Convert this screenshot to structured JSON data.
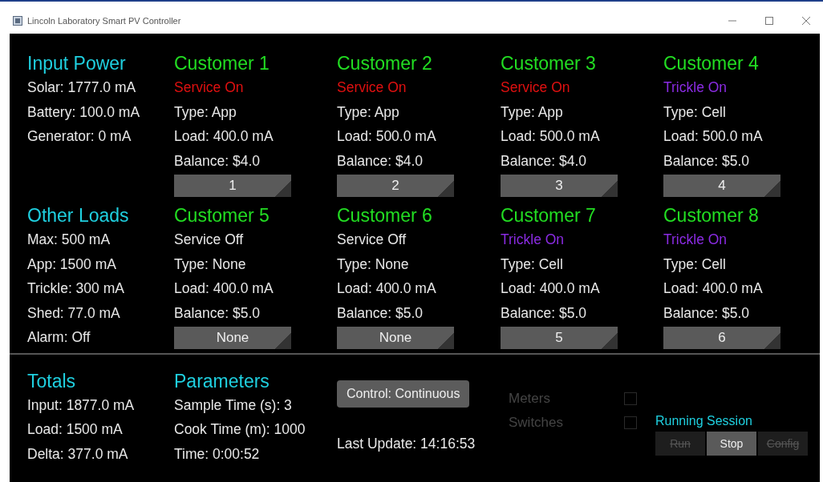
{
  "window": {
    "title": "Lincoln Laboratory Smart PV Controller"
  },
  "input_power": {
    "title": "Input Power",
    "lines": [
      "Solar: 1777.0 mA",
      "Battery: 100.0 mA",
      "Generator: 0 mA"
    ]
  },
  "other_loads": {
    "title": "Other Loads",
    "lines": [
      "Max: 500 mA",
      "App: 1500 mA",
      "Trickle: 300 mA",
      "Shed: 77.0 mA",
      "Alarm: Off"
    ]
  },
  "customers": [
    {
      "title": "Customer 1",
      "status": "Service On",
      "color": "#e01010",
      "type": "Type: App",
      "load": "Load: 400.0 mA",
      "balance": "Balance: $4.0",
      "button": "1"
    },
    {
      "title": "Customer 2",
      "status": "Service On",
      "color": "#e01010",
      "type": "Type: App",
      "load": "Load: 500.0 mA",
      "balance": "Balance: $4.0",
      "button": "2"
    },
    {
      "title": "Customer 3",
      "status": "Service On",
      "color": "#e01010",
      "type": "Type: App",
      "load": "Load: 500.0 mA",
      "balance": "Balance: $4.0",
      "button": "3"
    },
    {
      "title": "Customer 4",
      "status": "Trickle On",
      "color": "#8a2be2",
      "type": "Type: Cell",
      "load": "Load: 500.0 mA",
      "balance": "Balance: $5.0",
      "button": "4"
    },
    {
      "title": "Customer 5",
      "status": "Service Off",
      "color": "#e8e8e8",
      "type": "Type: None",
      "load": "Load: 400.0 mA",
      "balance": "Balance: $5.0",
      "button": "None"
    },
    {
      "title": "Customer 6",
      "status": "Service Off",
      "color": "#e8e8e8",
      "type": "Type: None",
      "load": "Load: 400.0 mA",
      "balance": "Balance: $5.0",
      "button": "None"
    },
    {
      "title": "Customer 7",
      "status": "Trickle On",
      "color": "#8a2be2",
      "type": "Type: Cell",
      "load": "Load: 400.0 mA",
      "balance": "Balance: $5.0",
      "button": "5"
    },
    {
      "title": "Customer 8",
      "status": "Trickle On",
      "color": "#8a2be2",
      "type": "Type: Cell",
      "load": "Load: 400.0 mA",
      "balance": "Balance: $5.0",
      "button": "6"
    }
  ],
  "totals": {
    "title": "Totals",
    "lines": [
      "Input: 1877.0 mA",
      "Load: 1500 mA",
      "Delta: 377.0 mA"
    ]
  },
  "parameters": {
    "title": "Parameters",
    "lines": [
      "Sample Time (s): 3",
      "Cook Time (m): 1000",
      "Time: 0:00:52"
    ]
  },
  "control_button": "Control: Continuous",
  "last_update": "Last Update: 14:16:53",
  "options": [
    {
      "label": "Meters",
      "checked": false,
      "disabled": true
    },
    {
      "label": "Switches",
      "checked": false,
      "disabled": true
    }
  ],
  "session_label": "Running Session",
  "session_buttons": [
    {
      "label": "Run",
      "disabled": true
    },
    {
      "label": "Stop",
      "disabled": false
    },
    {
      "label": "Config",
      "disabled": true
    }
  ]
}
